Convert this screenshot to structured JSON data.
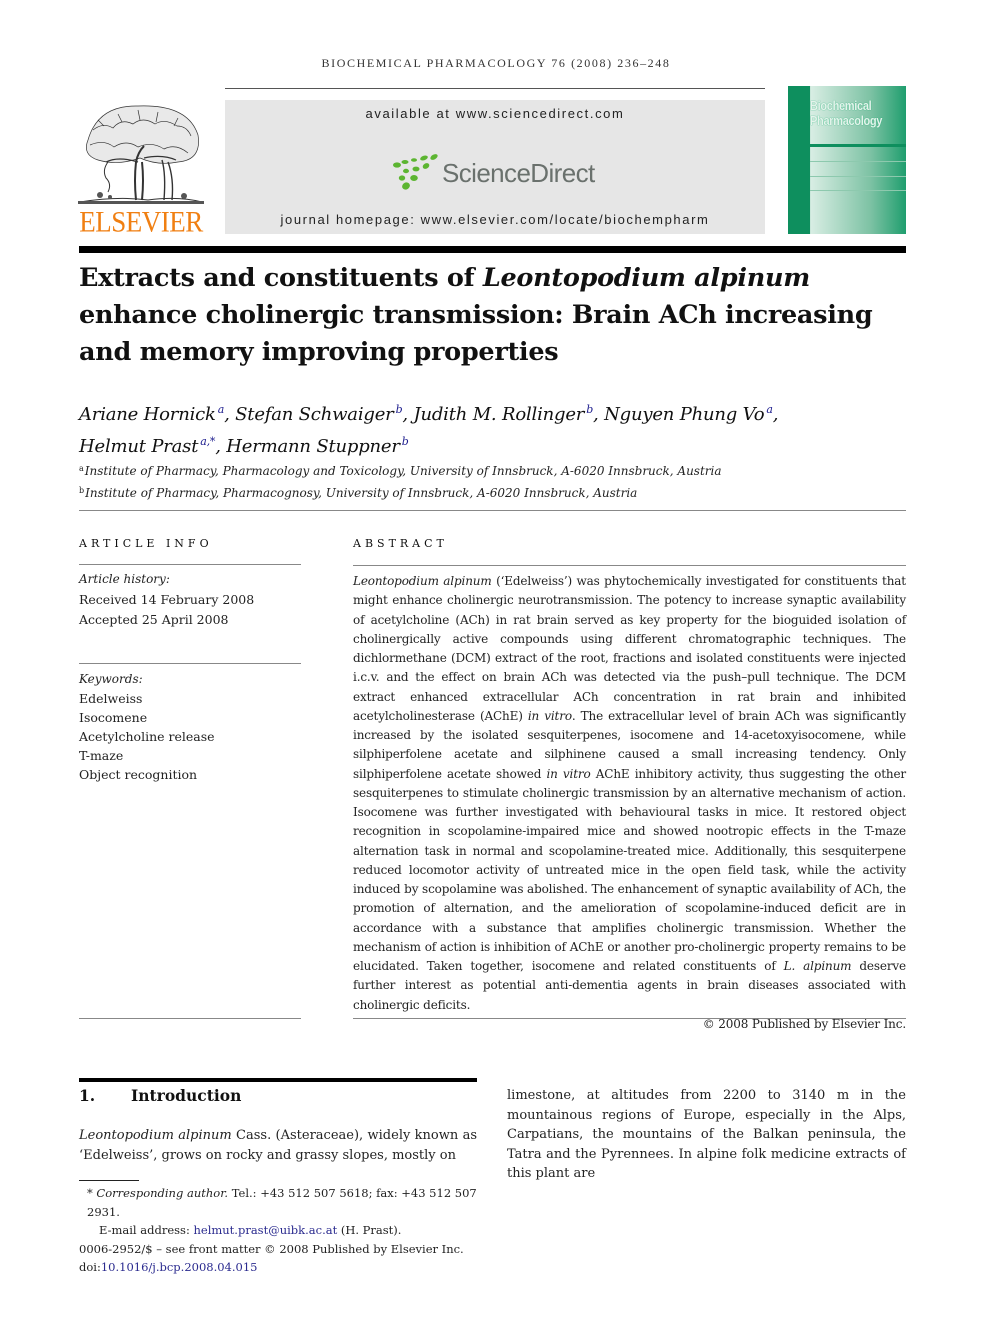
{
  "running_head": "BIOCHEMICAL PHARMACOLOGY 76 (2008) 236–248",
  "publisher": {
    "logo_text": "ELSEVIER",
    "brand_color": "#f07f12"
  },
  "sciencedirect": {
    "available_text": "available at www.sciencedirect.com",
    "logo_text": "ScienceDirect",
    "logo_color": "#6a716d",
    "dot_color": "#5cb531",
    "homepage_text": "journal homepage: www.elsevier.com/locate/biochempharm"
  },
  "journal_cover": {
    "title_line1": "Biochemical",
    "title_line2": "Pharmacology",
    "color": "#0e8f5e"
  },
  "article": {
    "title_part1": "Extracts and constituents of ",
    "title_italic": "Leontopodium alpinum",
    "title_part2": " enhance cholinergic transmission: Brain ACh increasing and memory improving properties",
    "authors": [
      {
        "name": "Ariane Hornick",
        "aff": "a"
      },
      {
        "name": "Stefan Schwaiger",
        "aff": "b"
      },
      {
        "name": "Judith M. Rollinger",
        "aff": "b"
      },
      {
        "name": "Nguyen Phung Vo",
        "aff": "a"
      },
      {
        "name": "Helmut Prast",
        "aff": "a,*"
      },
      {
        "name": "Hermann Stuppner",
        "aff": "b"
      }
    ],
    "affiliations": [
      {
        "key": "a",
        "text": "Institute of Pharmacy, Pharmacology and Toxicology, University of Innsbruck, A-6020 Innsbruck, Austria"
      },
      {
        "key": "b",
        "text": "Institute of Pharmacy, Pharmacognosy, University of Innsbruck, A-6020 Innsbruck, Austria"
      }
    ]
  },
  "article_info": {
    "heading": "ARTICLE INFO",
    "history_label": "Article history:",
    "received": "Received 14 February 2008",
    "accepted": "Accepted 25 April 2008",
    "keywords_label": "Keywords:",
    "keywords": [
      "Edelweiss",
      "Isocomene",
      "Acetylcholine release",
      "T-maze",
      "Object recognition"
    ]
  },
  "abstract": {
    "heading": "ABSTRACT",
    "segments": [
      {
        "italic": true,
        "text": "Leontopodium alpinum"
      },
      {
        "italic": false,
        "text": " (‘Edelweiss’) was phytochemically investigated for constituents that might enhance cholinergic neurotransmission. The potency to increase synaptic availability of acetylcholine (ACh) in rat brain served as key property for the bioguided isolation of cholinergically active compounds using different chromatographic techniques. The dichlormethane (DCM) extract of the root, fractions and isolated constituents were injected i.c.v. and the effect on brain ACh was detected via the push–pull technique. The DCM extract enhanced extracellular ACh concentration in rat brain and inhibited acetylcholinesterase (AChE) "
      },
      {
        "italic": true,
        "text": "in vitro"
      },
      {
        "italic": false,
        "text": ". The extracellular level of brain ACh was significantly increased by the isolated sesquiterpenes, isocomene and 14-acetoxyisocomene, while silphiperfolene acetate and silphinene caused a small increasing tendency. Only silphiperfolene acetate showed "
      },
      {
        "italic": true,
        "text": "in vitro"
      },
      {
        "italic": false,
        "text": " AChE inhibitory activity, thus suggesting the other sesquiterpenes to stimulate cholinergic transmission by an alternative mechanism of action. Isocomene was further investigated with behavioural tasks in mice. It restored object recognition in scopolamine-impaired mice and showed nootropic effects in the T-maze alternation task in normal and scopolamine-treated mice. Additionally, this sesquiterpene reduced locomotor activity of untreated mice in the open field task, while the activity induced by scopolamine was abolished. The enhancement of synaptic availability of ACh, the promotion of alternation, and the amelioration of scopolamine-induced deficit are in accordance with a substance that amplifies cholinergic transmission. Whether the mechanism of action is inhibition of AChE or another pro-cholinergic property remains to be elucidated. Taken together, isocomene and related constituents of "
      },
      {
        "italic": true,
        "text": "L. alpinum"
      },
      {
        "italic": false,
        "text": " deserve further interest as potential anti-dementia agents in brain diseases associated with cholinergic deficits."
      }
    ],
    "copyright": "© 2008 Published by Elsevier Inc."
  },
  "introduction": {
    "number": "1.",
    "heading": "Introduction",
    "left_italic": "Leontopodium alpinum",
    "left_text": " Cass. (Asteraceae), widely known as ‘Edelweiss’, grows on rocky and grassy slopes, mostly on",
    "right_text": "limestone, at altitudes from 2200 to 3140 m in the mountainous regions of Europe, especially in the Alps, Carpatians, the mountains of the Balkan peninsula, the Tatra and the Pyrennees. In alpine folk medicine extracts of this plant are"
  },
  "footnotes": {
    "corresponding_marker": "*",
    "corresponding_label": "Corresponding author.",
    "contact": " Tel.: +43 512 507 5618; fax: +43 512 507 2931.",
    "email_label": "E-mail address: ",
    "email": "helmut.prast@uibk.ac.at",
    "email_suffix": " (H. Prast).",
    "issn_line": "0006-2952/$ – see front matter © 2008 Published by Elsevier Inc.",
    "doi_label": "doi:",
    "doi": "10.1016/j.bcp.2008.04.015"
  }
}
